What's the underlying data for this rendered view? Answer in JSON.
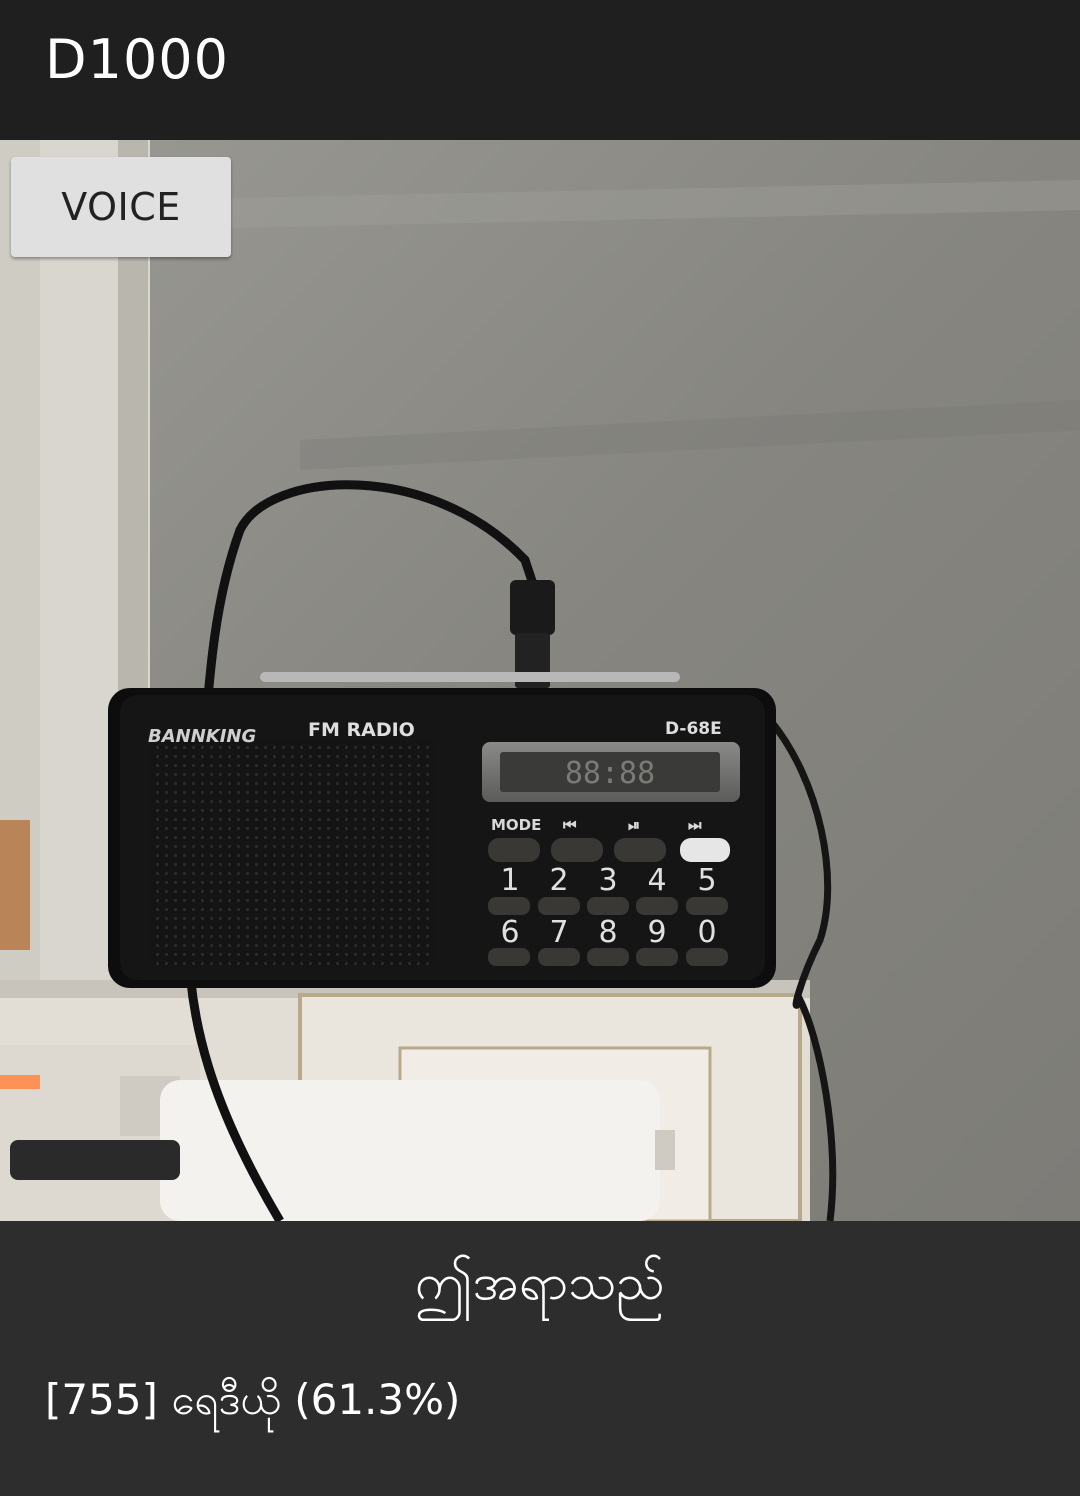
{
  "appbar": {
    "title": "D1000"
  },
  "camera": {
    "voice_label": "VOICE",
    "radio": {
      "brand": "BANNKING",
      "label": "FM RADIO",
      "model": "D-68E",
      "display": "88:88",
      "keys_top": [
        "MODE",
        "⏮",
        "⏯",
        "⏭"
      ],
      "keys_row1": [
        "1",
        "2",
        "3",
        "4",
        "5"
      ],
      "keys_row2": [
        "6",
        "7",
        "8",
        "9",
        "0"
      ]
    }
  },
  "result": {
    "caption": "ဤအရာသည်",
    "detection": "[755] ရေဒီယို (61.3%)"
  }
}
